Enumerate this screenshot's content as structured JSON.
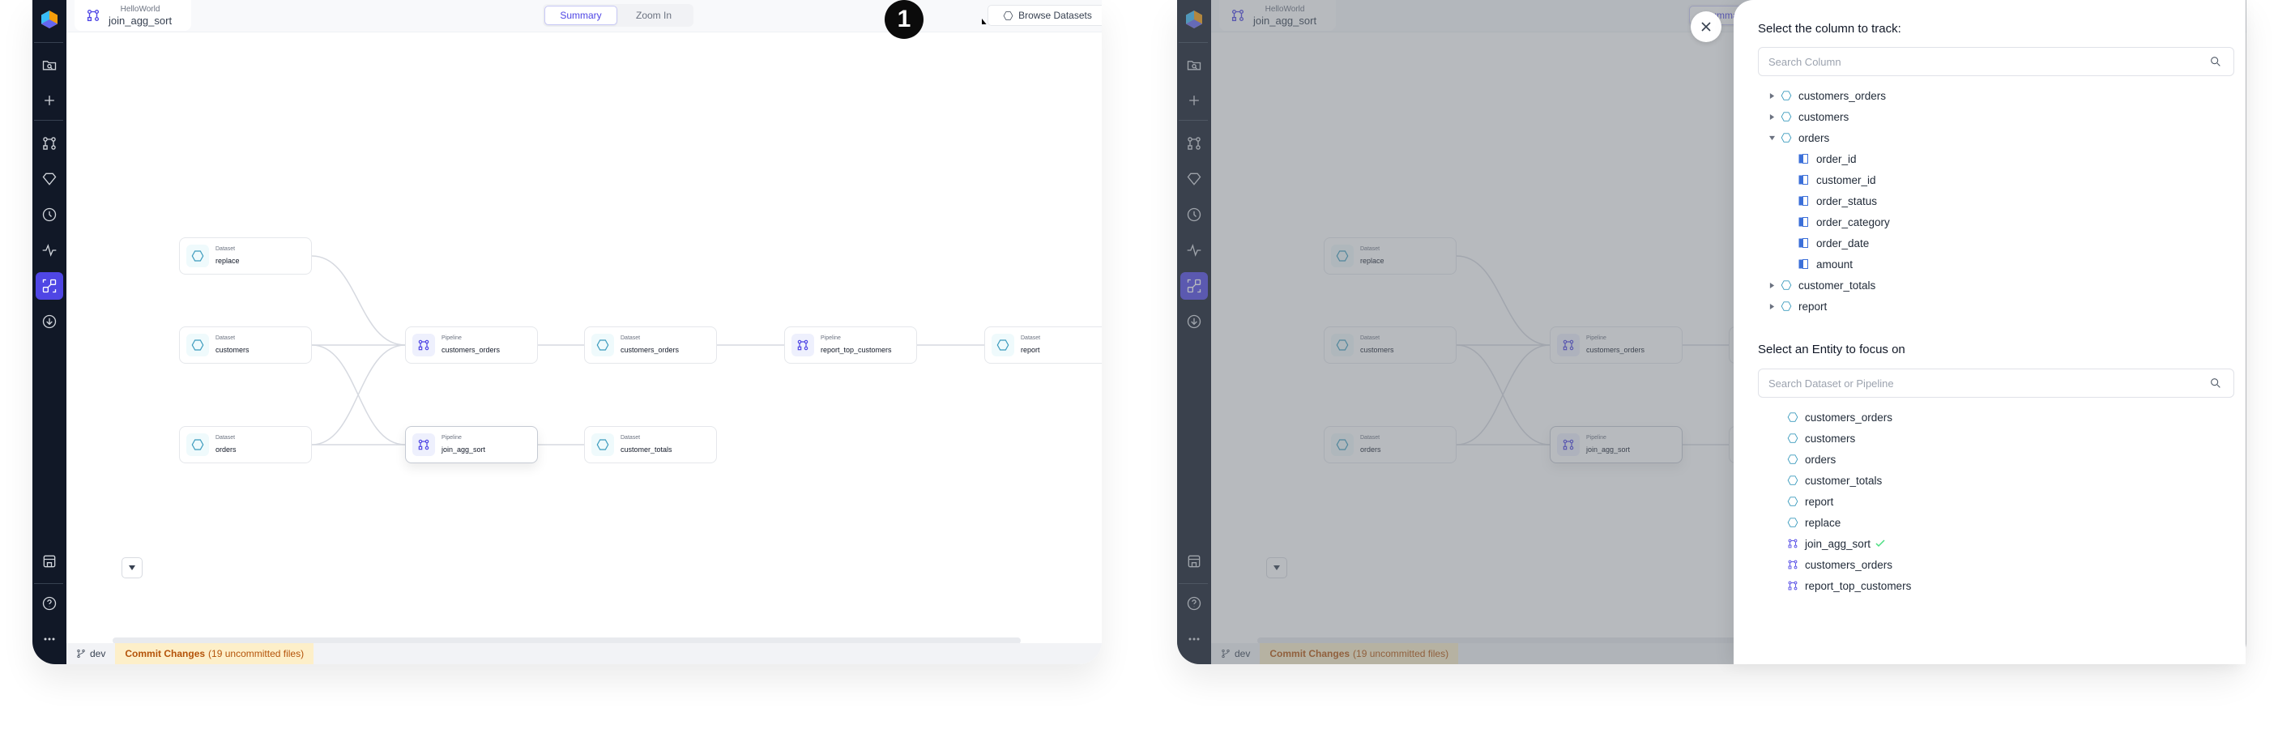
{
  "left_panel": {
    "breadcrumb": {
      "project": "HelloWorld",
      "pipeline": "join_agg_sort"
    },
    "view_toggle": {
      "options": [
        "Summary",
        "Zoom In"
      ],
      "selected": "Summary"
    },
    "browse_button": "Browse Datasets",
    "annotation": {
      "number": "1"
    },
    "nodes": [
      {
        "type": "Dataset",
        "name": "replace"
      },
      {
        "type": "Dataset",
        "name": "customers"
      },
      {
        "type": "Dataset",
        "name": "orders"
      },
      {
        "type": "Pipeline",
        "name": "customers_orders"
      },
      {
        "type": "Pipeline",
        "name": "join_agg_sort"
      },
      {
        "type": "Dataset",
        "name": "customers_orders"
      },
      {
        "type": "Dataset",
        "name": "customer_totals"
      },
      {
        "type": "Pipeline",
        "name": "report_top_customers"
      },
      {
        "type": "Dataset",
        "name": "report"
      }
    ],
    "status": {
      "branch": "dev",
      "commit_label": "Commit Changes",
      "commit_detail": "(19 uncommitted files)"
    }
  },
  "right_panel": {
    "breadcrumb": {
      "project": "HelloWorld",
      "pipeline": "join_agg_sort"
    },
    "view_toggle": {
      "selected": "Summary"
    },
    "status": {
      "branch": "dev",
      "commit_label": "Commit Changes",
      "commit_detail": "(19 uncommitted files)"
    },
    "drawer": {
      "column_title": "Select the column to track:",
      "column_search_placeholder": "Search Column",
      "column_tree": [
        {
          "name": "customers_orders",
          "expanded": false
        },
        {
          "name": "customers",
          "expanded": false
        },
        {
          "name": "orders",
          "expanded": true,
          "columns": [
            "order_id",
            "customer_id",
            "order_status",
            "order_category",
            "order_date",
            "amount"
          ]
        },
        {
          "name": "customer_totals",
          "expanded": false
        },
        {
          "name": "report",
          "expanded": false
        }
      ],
      "entity_title": "Select an Entity to focus on",
      "entity_search_placeholder": "Search Dataset or Pipeline",
      "entities": [
        {
          "type": "dataset",
          "name": "customers_orders"
        },
        {
          "type": "dataset",
          "name": "customers"
        },
        {
          "type": "dataset",
          "name": "orders"
        },
        {
          "type": "dataset",
          "name": "customer_totals"
        },
        {
          "type": "dataset",
          "name": "report"
        },
        {
          "type": "dataset",
          "name": "replace"
        },
        {
          "type": "pipeline",
          "name": "join_agg_sort",
          "selected": true
        },
        {
          "type": "pipeline",
          "name": "customers_orders"
        },
        {
          "type": "pipeline",
          "name": "report_top_customers"
        }
      ]
    }
  }
}
